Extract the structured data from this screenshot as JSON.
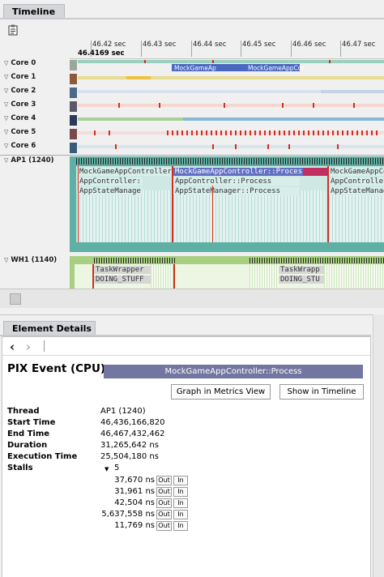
{
  "timeline": {
    "tab_label": "Timeline",
    "cursor_time": "46.4169 sec",
    "ticks": [
      "46.42 sec",
      "46.43 sec",
      "46.44 sec",
      "46.45 sec",
      "46.46 sec",
      "46.47 sec"
    ],
    "cores": [
      {
        "label": "Core 0",
        "color": "#c0c8d8"
      },
      {
        "label": "Core 1",
        "color": "#e8d888"
      },
      {
        "label": "Core 2",
        "color": "#ccd8e6"
      },
      {
        "label": "Core 3",
        "color": "#eec8c0"
      },
      {
        "label": "Core 4",
        "color": "#a8c898"
      },
      {
        "label": "Core 5",
        "color": "#e6b0b0"
      },
      {
        "label": "Core 6",
        "color": "#b8c8dc"
      }
    ],
    "core0_events": [
      "MockGameAp",
      "MockGameAppCor"
    ],
    "threads": [
      {
        "label": "AP1 (1240)",
        "scopes": [
          {
            "text": "MockGameAppController",
            "row": 0
          },
          {
            "text": "MockGameAppController::Process",
            "row": 0
          },
          {
            "text": "MockGameAppControll",
            "row": 0
          },
          {
            "text": "AppController::",
            "row": 1
          },
          {
            "text": "AppController::Process",
            "row": 1
          },
          {
            "text": "AppController::Pr",
            "row": 1
          },
          {
            "text": "AppStateManage",
            "row": 2
          },
          {
            "text": "AppStateManager::Process",
            "row": 2
          },
          {
            "text": "AppStateManager::",
            "row": 2
          }
        ]
      },
      {
        "label": "WH1 (1140)",
        "scopes": [
          {
            "text": "TaskWrapper",
            "row": 0
          },
          {
            "text": "TaskWrapp",
            "row": 0
          },
          {
            "text": "DOING_STUFF",
            "row": 1
          },
          {
            "text": "DOING_STU",
            "row": 1
          }
        ]
      }
    ]
  },
  "details": {
    "tab_label": "Element Details",
    "title": "PIX Event (CPU)",
    "event_name": "MockGameAppController::Process",
    "graph_button": "Graph in Metrics View",
    "timeline_button": "Show in Timeline",
    "props": [
      {
        "label": "Thread",
        "value": "AP1 (1240)"
      },
      {
        "label": "Start Time",
        "value": "46,436,166,820"
      },
      {
        "label": "End Time",
        "value": "46,467,432,462"
      },
      {
        "label": "Duration",
        "value": "31,265,642 ns"
      },
      {
        "label": "Execution Time",
        "value": "25,504,180 ns"
      },
      {
        "label": "Stalls",
        "value": "5"
      }
    ],
    "stalls": [
      {
        "value": "37,670 ns",
        "out": "Out",
        "in": "In"
      },
      {
        "value": "31,961 ns",
        "out": "Out",
        "in": "In"
      },
      {
        "value": "42,504 ns",
        "out": "Out",
        "in": "In"
      },
      {
        "value": "5,637,558 ns",
        "out": "Out",
        "in": "In"
      },
      {
        "value": "11,769 ns",
        "out": "Out",
        "in": "In"
      }
    ]
  }
}
